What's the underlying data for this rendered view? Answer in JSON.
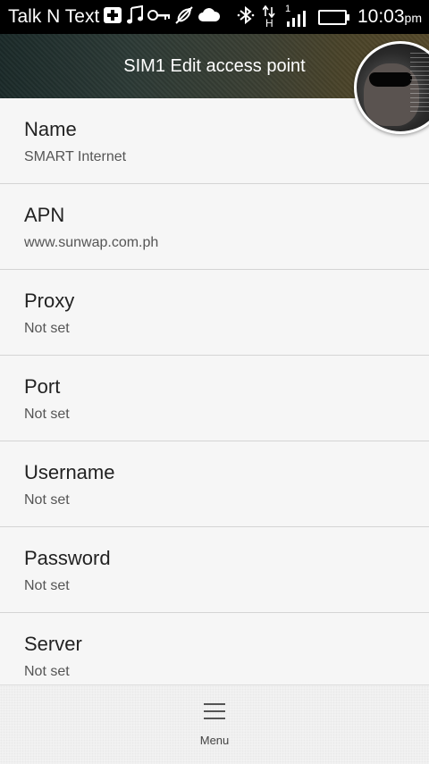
{
  "status_bar": {
    "carrier": "Talk N Text",
    "signal_indicator": "1",
    "network_indicator": "H",
    "time": "10:03",
    "ampm": "pm",
    "icons": [
      "medical-plus-icon",
      "music-note-icon",
      "key-icon",
      "satellite-icon",
      "cloud-icon",
      "bluetooth-icon",
      "data-arrows-icon",
      "signal-bars-icon",
      "battery-icon"
    ]
  },
  "action_bar": {
    "title": "SIM1 Edit access point"
  },
  "settings": [
    {
      "label": "Name",
      "value": "SMART Internet"
    },
    {
      "label": "APN",
      "value": "www.sunwap.com.ph"
    },
    {
      "label": "Proxy",
      "value": "Not set"
    },
    {
      "label": "Port",
      "value": "Not set"
    },
    {
      "label": "Username",
      "value": "Not set"
    },
    {
      "label": "Password",
      "value": "Not set"
    },
    {
      "label": "Server",
      "value": "Not set"
    }
  ],
  "bottom_bar": {
    "menu_label": "Menu",
    "menu_icon": "hamburger-menu-icon"
  }
}
